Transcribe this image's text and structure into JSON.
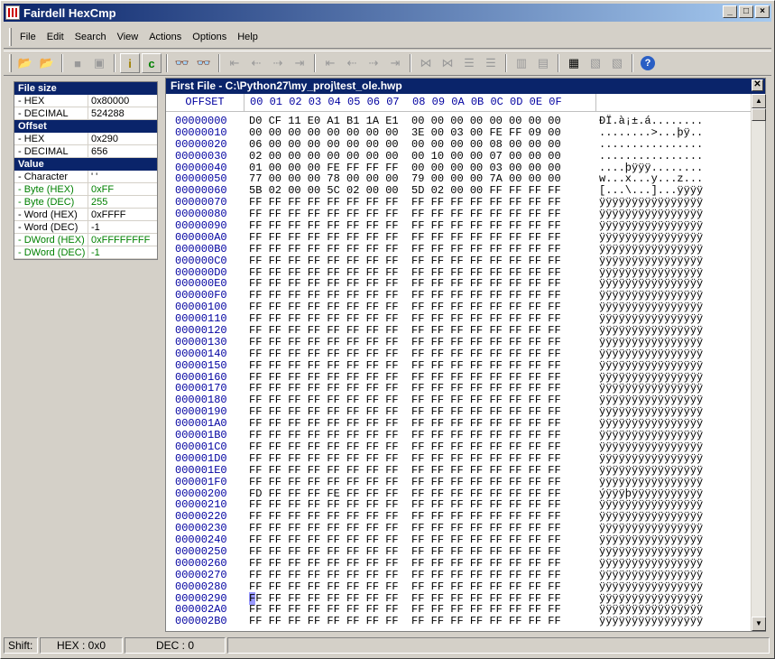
{
  "window": {
    "title": "Fairdell HexCmp",
    "buttons": [
      "_",
      "□",
      "×"
    ]
  },
  "menu": [
    "File",
    "Edit",
    "Search",
    "View",
    "Actions",
    "Options",
    "Help"
  ],
  "left_panel": {
    "rows": [
      {
        "k": "File size",
        "v": "",
        "head": true
      },
      {
        "k": " - HEX",
        "v": "0x80000"
      },
      {
        "k": " - DECIMAL",
        "v": "524288"
      },
      {
        "k": "Offset",
        "v": "",
        "head": true
      },
      {
        "k": " - HEX",
        "v": "0x290"
      },
      {
        "k": " - DECIMAL",
        "v": "656"
      },
      {
        "k": "Value",
        "v": "",
        "head": true
      },
      {
        "k": " - Character",
        "v": "' '"
      },
      {
        "k": " - Byte (HEX)",
        "v": "0xFF",
        "green": true
      },
      {
        "k": " - Byte (DEC)",
        "v": "255",
        "green": true
      },
      {
        "k": " - Word (HEX)",
        "v": "0xFFFF"
      },
      {
        "k": " - Word (DEC)",
        "v": "-1"
      },
      {
        "k": " - DWord (HEX)",
        "v": "0xFFFFFFFF",
        "green": true
      },
      {
        "k": " - DWord (DEC)",
        "v": "-1",
        "green": true
      }
    ]
  },
  "file_panel": {
    "title": "First File - C:\\Python27\\my_proj\\test_ole.hwp",
    "offset_header": "OFFSET",
    "col_header": "00 01 02 03 04 05 06 07  08 09 0A 0B 0C 0D 0E 0F",
    "rows": [
      {
        "off": "00000000",
        "hex": "D0 CF 11 E0 A1 B1 1A E1  00 00 00 00 00 00 00 00",
        "asc": "ÐÏ.à¡±.á........"
      },
      {
        "off": "00000010",
        "hex": "00 00 00 00 00 00 00 00  3E 00 03 00 FE FF 09 00",
        "asc": "........>...þÿ.."
      },
      {
        "off": "00000020",
        "hex": "06 00 00 00 00 00 00 00  00 00 00 00 08 00 00 00",
        "asc": "................"
      },
      {
        "off": "00000030",
        "hex": "02 00 00 00 00 00 00 00  00 10 00 00 07 00 00 00",
        "asc": "................"
      },
      {
        "off": "00000040",
        "hex": "01 00 00 00 FE FF FF FF  00 00 00 00 03 00 00 00",
        "asc": "....þÿÿÿ........"
      },
      {
        "off": "00000050",
        "hex": "77 00 00 00 78 00 00 00  79 00 00 00 7A 00 00 00",
        "asc": "w...x...y...z..."
      },
      {
        "off": "00000060",
        "hex": "5B 02 00 00 5C 02 00 00  5D 02 00 00 FF FF FF FF",
        "asc": "[...\\...]...ÿÿÿÿ"
      },
      {
        "off": "00000070",
        "hex": "FF FF FF FF FF FF FF FF  FF FF FF FF FF FF FF FF",
        "asc": "ÿÿÿÿÿÿÿÿÿÿÿÿÿÿÿÿ"
      },
      {
        "off": "00000080",
        "hex": "FF FF FF FF FF FF FF FF  FF FF FF FF FF FF FF FF",
        "asc": "ÿÿÿÿÿÿÿÿÿÿÿÿÿÿÿÿ"
      },
      {
        "off": "00000090",
        "hex": "FF FF FF FF FF FF FF FF  FF FF FF FF FF FF FF FF",
        "asc": "ÿÿÿÿÿÿÿÿÿÿÿÿÿÿÿÿ"
      },
      {
        "off": "000000A0",
        "hex": "FF FF FF FF FF FF FF FF  FF FF FF FF FF FF FF FF",
        "asc": "ÿÿÿÿÿÿÿÿÿÿÿÿÿÿÿÿ"
      },
      {
        "off": "000000B0",
        "hex": "FF FF FF FF FF FF FF FF  FF FF FF FF FF FF FF FF",
        "asc": "ÿÿÿÿÿÿÿÿÿÿÿÿÿÿÿÿ"
      },
      {
        "off": "000000C0",
        "hex": "FF FF FF FF FF FF FF FF  FF FF FF FF FF FF FF FF",
        "asc": "ÿÿÿÿÿÿÿÿÿÿÿÿÿÿÿÿ"
      },
      {
        "off": "000000D0",
        "hex": "FF FF FF FF FF FF FF FF  FF FF FF FF FF FF FF FF",
        "asc": "ÿÿÿÿÿÿÿÿÿÿÿÿÿÿÿÿ"
      },
      {
        "off": "000000E0",
        "hex": "FF FF FF FF FF FF FF FF  FF FF FF FF FF FF FF FF",
        "asc": "ÿÿÿÿÿÿÿÿÿÿÿÿÿÿÿÿ"
      },
      {
        "off": "000000F0",
        "hex": "FF FF FF FF FF FF FF FF  FF FF FF FF FF FF FF FF",
        "asc": "ÿÿÿÿÿÿÿÿÿÿÿÿÿÿÿÿ"
      },
      {
        "off": "00000100",
        "hex": "FF FF FF FF FF FF FF FF  FF FF FF FF FF FF FF FF",
        "asc": "ÿÿÿÿÿÿÿÿÿÿÿÿÿÿÿÿ"
      },
      {
        "off": "00000110",
        "hex": "FF FF FF FF FF FF FF FF  FF FF FF FF FF FF FF FF",
        "asc": "ÿÿÿÿÿÿÿÿÿÿÿÿÿÿÿÿ"
      },
      {
        "off": "00000120",
        "hex": "FF FF FF FF FF FF FF FF  FF FF FF FF FF FF FF FF",
        "asc": "ÿÿÿÿÿÿÿÿÿÿÿÿÿÿÿÿ"
      },
      {
        "off": "00000130",
        "hex": "FF FF FF FF FF FF FF FF  FF FF FF FF FF FF FF FF",
        "asc": "ÿÿÿÿÿÿÿÿÿÿÿÿÿÿÿÿ"
      },
      {
        "off": "00000140",
        "hex": "FF FF FF FF FF FF FF FF  FF FF FF FF FF FF FF FF",
        "asc": "ÿÿÿÿÿÿÿÿÿÿÿÿÿÿÿÿ"
      },
      {
        "off": "00000150",
        "hex": "FF FF FF FF FF FF FF FF  FF FF FF FF FF FF FF FF",
        "asc": "ÿÿÿÿÿÿÿÿÿÿÿÿÿÿÿÿ"
      },
      {
        "off": "00000160",
        "hex": "FF FF FF FF FF FF FF FF  FF FF FF FF FF FF FF FF",
        "asc": "ÿÿÿÿÿÿÿÿÿÿÿÿÿÿÿÿ"
      },
      {
        "off": "00000170",
        "hex": "FF FF FF FF FF FF FF FF  FF FF FF FF FF FF FF FF",
        "asc": "ÿÿÿÿÿÿÿÿÿÿÿÿÿÿÿÿ"
      },
      {
        "off": "00000180",
        "hex": "FF FF FF FF FF FF FF FF  FF FF FF FF FF FF FF FF",
        "asc": "ÿÿÿÿÿÿÿÿÿÿÿÿÿÿÿÿ"
      },
      {
        "off": "00000190",
        "hex": "FF FF FF FF FF FF FF FF  FF FF FF FF FF FF FF FF",
        "asc": "ÿÿÿÿÿÿÿÿÿÿÿÿÿÿÿÿ"
      },
      {
        "off": "000001A0",
        "hex": "FF FF FF FF FF FF FF FF  FF FF FF FF FF FF FF FF",
        "asc": "ÿÿÿÿÿÿÿÿÿÿÿÿÿÿÿÿ"
      },
      {
        "off": "000001B0",
        "hex": "FF FF FF FF FF FF FF FF  FF FF FF FF FF FF FF FF",
        "asc": "ÿÿÿÿÿÿÿÿÿÿÿÿÿÿÿÿ"
      },
      {
        "off": "000001C0",
        "hex": "FF FF FF FF FF FF FF FF  FF FF FF FF FF FF FF FF",
        "asc": "ÿÿÿÿÿÿÿÿÿÿÿÿÿÿÿÿ"
      },
      {
        "off": "000001D0",
        "hex": "FF FF FF FF FF FF FF FF  FF FF FF FF FF FF FF FF",
        "asc": "ÿÿÿÿÿÿÿÿÿÿÿÿÿÿÿÿ"
      },
      {
        "off": "000001E0",
        "hex": "FF FF FF FF FF FF FF FF  FF FF FF FF FF FF FF FF",
        "asc": "ÿÿÿÿÿÿÿÿÿÿÿÿÿÿÿÿ"
      },
      {
        "off": "000001F0",
        "hex": "FF FF FF FF FF FF FF FF  FF FF FF FF FF FF FF FF",
        "asc": "ÿÿÿÿÿÿÿÿÿÿÿÿÿÿÿÿ"
      },
      {
        "off": "00000200",
        "hex": "FD FF FF FF FE FF FF FF  FF FF FF FF FF FF FF FF",
        "asc": "ýÿÿÿþÿÿÿÿÿÿÿÿÿÿÿ"
      },
      {
        "off": "00000210",
        "hex": "FF FF FF FF FF FF FF FF  FF FF FF FF FF FF FF FF",
        "asc": "ÿÿÿÿÿÿÿÿÿÿÿÿÿÿÿÿ"
      },
      {
        "off": "00000220",
        "hex": "FF FF FF FF FF FF FF FF  FF FF FF FF FF FF FF FF",
        "asc": "ÿÿÿÿÿÿÿÿÿÿÿÿÿÿÿÿ"
      },
      {
        "off": "00000230",
        "hex": "FF FF FF FF FF FF FF FF  FF FF FF FF FF FF FF FF",
        "asc": "ÿÿÿÿÿÿÿÿÿÿÿÿÿÿÿÿ"
      },
      {
        "off": "00000240",
        "hex": "FF FF FF FF FF FF FF FF  FF FF FF FF FF FF FF FF",
        "asc": "ÿÿÿÿÿÿÿÿÿÿÿÿÿÿÿÿ"
      },
      {
        "off": "00000250",
        "hex": "FF FF FF FF FF FF FF FF  FF FF FF FF FF FF FF FF",
        "asc": "ÿÿÿÿÿÿÿÿÿÿÿÿÿÿÿÿ"
      },
      {
        "off": "00000260",
        "hex": "FF FF FF FF FF FF FF FF  FF FF FF FF FF FF FF FF",
        "asc": "ÿÿÿÿÿÿÿÿÿÿÿÿÿÿÿÿ"
      },
      {
        "off": "00000270",
        "hex": "FF FF FF FF FF FF FF FF  FF FF FF FF FF FF FF FF",
        "asc": "ÿÿÿÿÿÿÿÿÿÿÿÿÿÿÿÿ"
      },
      {
        "off": "00000280",
        "hex": "FF FF FF FF FF FF FF FF  FF FF FF FF FF FF FF FF",
        "asc": "ÿÿÿÿÿÿÿÿÿÿÿÿÿÿÿÿ"
      },
      {
        "off": "00000290",
        "hex": "FF FF FF FF FF FF FF FF  FF FF FF FF FF FF FF FF",
        "asc": "ÿÿÿÿÿÿÿÿÿÿÿÿÿÿÿÿ",
        "sel": true
      },
      {
        "off": "000002A0",
        "hex": "FF FF FF FF FF FF FF FF  FF FF FF FF FF FF FF FF",
        "asc": "ÿÿÿÿÿÿÿÿÿÿÿÿÿÿÿÿ"
      },
      {
        "off": "000002B0",
        "hex": "FF FF FF FF FF FF FF FF  FF FF FF FF FF FF FF FF",
        "asc": "ÿÿÿÿÿÿÿÿÿÿÿÿÿÿÿÿ"
      }
    ]
  },
  "status": {
    "shift": "Shift:",
    "hex": "HEX : 0x0",
    "dec": "DEC : 0"
  }
}
